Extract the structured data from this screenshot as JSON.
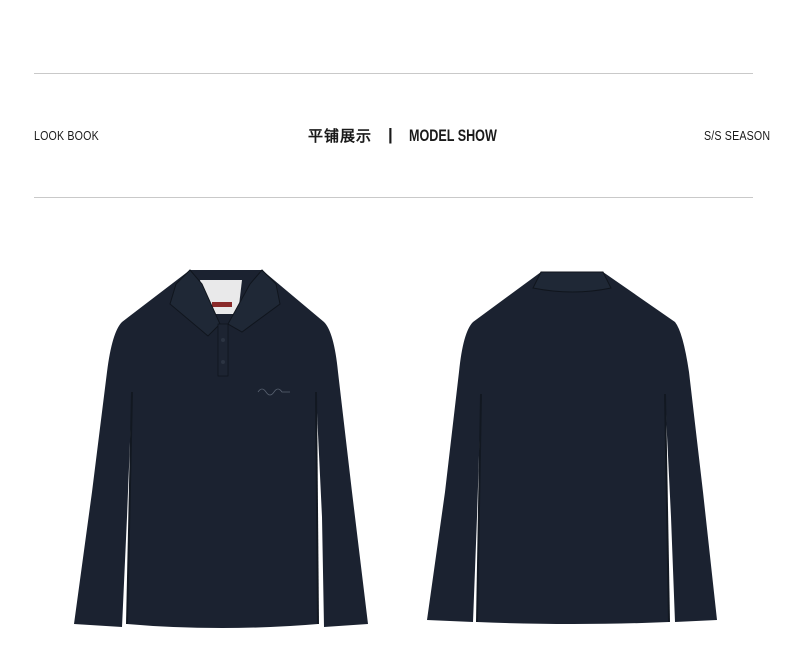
{
  "header": {
    "left_label": "LOOK BOOK",
    "center_cn": "平铺展示",
    "center_separator": "|",
    "center_en": "MODEL SHOW",
    "right_label": "S/S SEASON"
  },
  "products": [
    {
      "view": "front",
      "color": "#1b2230"
    },
    {
      "view": "back",
      "color": "#1b2230"
    }
  ],
  "colors": {
    "background": "#ffffff",
    "rule": "#c9c9c9",
    "garment": "#1b2230"
  }
}
